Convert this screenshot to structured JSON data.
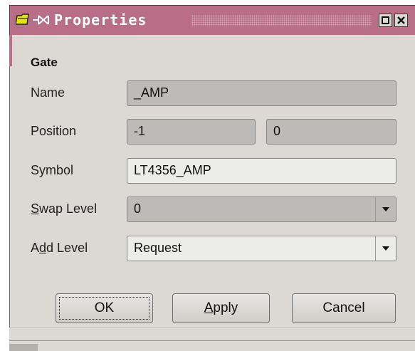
{
  "window": {
    "title": "Properties",
    "icons": {
      "app": "folder-icon",
      "pin": "pin-icon",
      "maximize": "maximize-icon",
      "close": "close-icon"
    },
    "colors": {
      "titlebar": "#b86e86",
      "background": "#dcd9d4"
    }
  },
  "group": {
    "title": "Gate"
  },
  "fields": {
    "name": {
      "label": "Name",
      "value": "_AMP"
    },
    "position": {
      "label": "Position",
      "x": "-1",
      "y": "0"
    },
    "symbol": {
      "label": "Symbol",
      "value": "LT4356_AMP"
    },
    "swap_level": {
      "label_mnemonic": "S",
      "label_rest": "wap Level",
      "value": "0"
    },
    "add_level": {
      "label_pre": "A",
      "label_mnemonic": "d",
      "label_rest": "d Level",
      "value": "Request"
    }
  },
  "buttons": {
    "ok": "OK",
    "apply_mnemonic": "A",
    "apply_rest": "pply",
    "cancel": "Cancel"
  }
}
